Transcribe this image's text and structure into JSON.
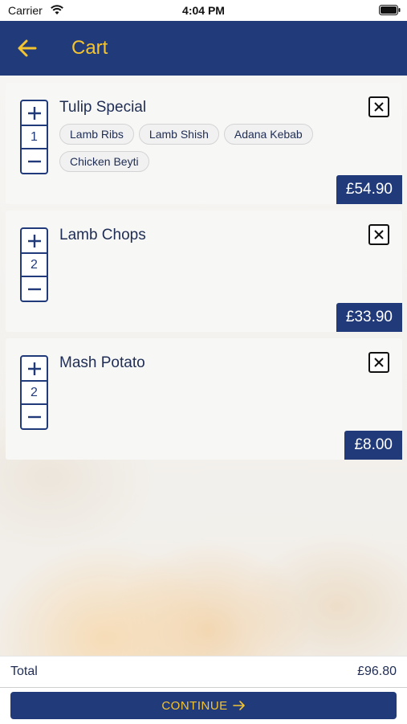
{
  "status_bar": {
    "carrier": "Carrier",
    "time": "4:04 PM"
  },
  "header": {
    "title": "Cart",
    "back_icon": "arrow-left-icon"
  },
  "colors": {
    "brand_navy": "#213a7a",
    "accent_yellow": "#f4c430"
  },
  "cart": {
    "items": [
      {
        "name": "Tulip Special",
        "quantity": "1",
        "options": [
          "Lamb Ribs",
          "Lamb Shish",
          "Adana Kebab",
          "Chicken Beyti"
        ],
        "price": "£54.90"
      },
      {
        "name": "Lamb Chops",
        "quantity": "2",
        "options": [],
        "price": "£33.90"
      },
      {
        "name": "Mash Potato",
        "quantity": "2",
        "options": [],
        "price": "£8.00"
      }
    ]
  },
  "summary": {
    "total_label": "Total",
    "total_value": "£96.80"
  },
  "actions": {
    "continue_label": "CONTINUE"
  }
}
